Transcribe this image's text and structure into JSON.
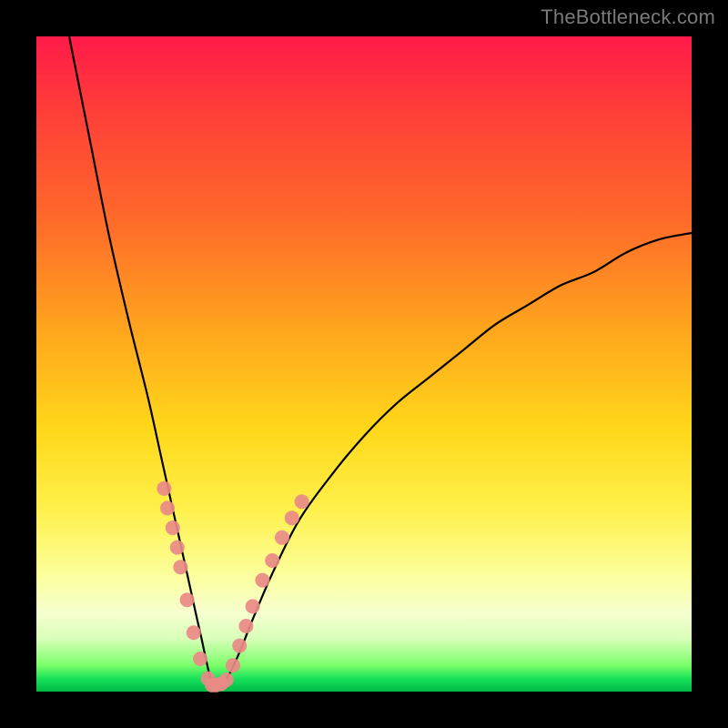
{
  "watermark": {
    "text": "TheBottleneck.com"
  },
  "colors": {
    "frame": "#000000",
    "curve": "#000000",
    "marker": "#e98a87",
    "gradient_stops": [
      "#ff1a49",
      "#ff3a3a",
      "#ff6a2a",
      "#ffa61d",
      "#ffd81a",
      "#fff04a",
      "#fcff9a",
      "#f6ffd0",
      "#d8ffb8",
      "#7bff6a",
      "#18e25a",
      "#00b845"
    ]
  },
  "chart_data": {
    "type": "line",
    "title": "",
    "xlabel": "",
    "ylabel": "",
    "xlim": [
      0,
      100
    ],
    "ylim": [
      0,
      100
    ],
    "notes": "V-shaped bottleneck curve. Minimum (0%) near x≈27. Left branch climbs to ~100% at x≈5; right branch rises toward ~70% at x=100. Salmon markers cluster around the trough on both branches between roughly y=0 and y=30.",
    "series": [
      {
        "name": "bottleneck-curve",
        "x": [
          5,
          8,
          11,
          14,
          17,
          19,
          21,
          23,
          25,
          27,
          29,
          31,
          33,
          36,
          40,
          45,
          50,
          55,
          60,
          65,
          70,
          75,
          80,
          85,
          90,
          95,
          100
        ],
        "y": [
          100,
          85,
          70,
          57,
          45,
          36,
          27,
          18,
          9,
          1,
          2,
          6,
          11,
          18,
          26,
          33,
          39,
          44,
          48,
          52,
          56,
          59,
          62,
          64,
          67,
          69,
          70
        ]
      }
    ],
    "markers": [
      {
        "name": "left-branch-markers",
        "x": [
          19.5,
          20.0,
          20.8,
          21.5,
          22.0,
          23.0,
          24.0,
          25.0,
          26.2
        ],
        "y": [
          31.0,
          28.0,
          25.0,
          22.0,
          19.0,
          14.0,
          9.0,
          5.0,
          2.0
        ]
      },
      {
        "name": "trough-markers",
        "x": [
          26.8,
          27.4,
          28.2,
          29.0
        ],
        "y": [
          1.0,
          1.0,
          1.2,
          1.8
        ]
      },
      {
        "name": "right-branch-markers",
        "x": [
          30.0,
          31.0,
          32.0,
          33.0,
          34.5,
          36.0,
          37.5,
          39.0,
          40.5
        ],
        "y": [
          4.0,
          7.0,
          10.0,
          13.0,
          17.0,
          20.0,
          23.5,
          26.5,
          29.0
        ]
      }
    ]
  }
}
